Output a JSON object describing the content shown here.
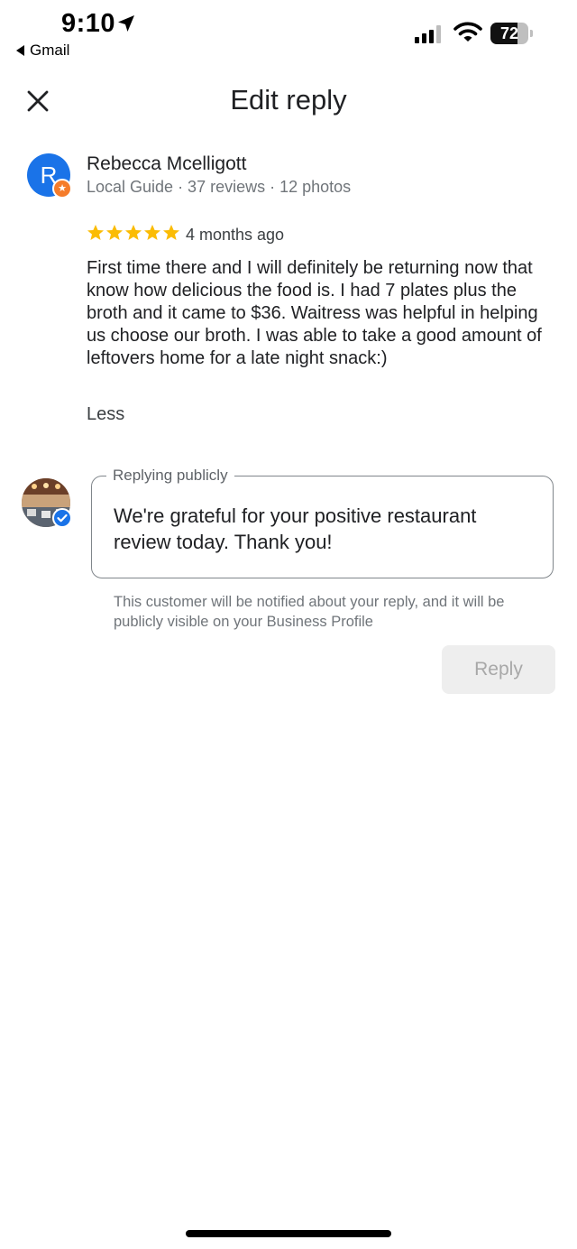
{
  "status_bar": {
    "time": "9:10",
    "back_app": "Gmail",
    "battery": "72",
    "battery_level": 0.72,
    "icons": [
      "location-arrow-icon",
      "signal-icon",
      "wifi-icon",
      "battery-icon"
    ]
  },
  "header": {
    "title": "Edit reply",
    "close_icon": "close-icon"
  },
  "review": {
    "avatar_initial": "R",
    "reviewer_name": "Rebecca Mcelligott",
    "meta": "Local Guide · 37 reviews · 12 photos",
    "rating": 5,
    "time_ago": "4 months ago",
    "text": "First time there and I will definitely be returning now that know how delicious the food is. I had 7 plates plus the broth and it came to $36. Waitress was helpful in helping us choose our broth. I was able to take a good amount of leftovers home for a late night snack:)",
    "less_label": "Less"
  },
  "reply": {
    "field_label": "Replying publicly",
    "value": "We're grateful for your positive restaurant review today. Thank you!",
    "notice": "This customer will be notified about your reply, and it will be publicly visible on your Business Profile",
    "button_label": "Reply"
  },
  "colors": {
    "avatar_blue": "#1a73e8",
    "star_yellow": "#fbbc04",
    "guide_orange": "#f57c2b",
    "verified_blue": "#1a73e8",
    "disabled_button_bg": "#eeeeee"
  }
}
